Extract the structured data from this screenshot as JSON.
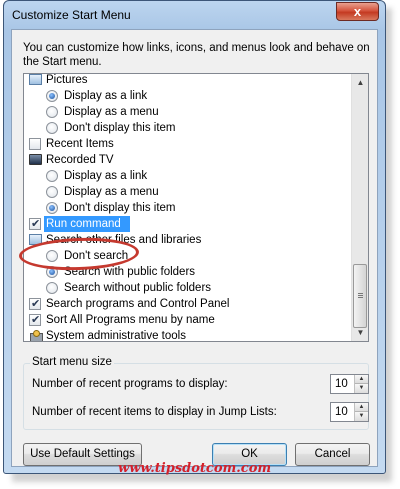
{
  "window": {
    "title": "Customize Start Menu",
    "close_glyph": "x",
    "intro": "You can customize how links, icons, and menus look and behave on the Start menu."
  },
  "list": {
    "rows": [
      {
        "kind": "header",
        "icon": "pictures-icon",
        "label": "Pictures"
      },
      {
        "kind": "radio",
        "checked": true,
        "label": "Display as a link"
      },
      {
        "kind": "radio",
        "checked": false,
        "label": "Display as a menu"
      },
      {
        "kind": "radio",
        "checked": false,
        "label": "Don't display this item"
      },
      {
        "kind": "check",
        "checked": false,
        "label": "Recent Items"
      },
      {
        "kind": "header",
        "icon": "recorded-tv-icon",
        "label": "Recorded TV"
      },
      {
        "kind": "radio",
        "checked": false,
        "label": "Display as a link"
      },
      {
        "kind": "radio",
        "checked": false,
        "label": "Display as a menu"
      },
      {
        "kind": "radio",
        "checked": true,
        "label": "Don't display this item"
      },
      {
        "kind": "check",
        "checked": true,
        "label": "Run command",
        "selected": true
      },
      {
        "kind": "header",
        "icon": "search-icon",
        "label": "Search other files and libraries"
      },
      {
        "kind": "radio",
        "checked": false,
        "label": "Don't search"
      },
      {
        "kind": "radio",
        "checked": true,
        "label": "Search with public folders"
      },
      {
        "kind": "radio",
        "checked": false,
        "label": "Search without public folders"
      },
      {
        "kind": "check",
        "checked": true,
        "label": "Search programs and Control Panel"
      },
      {
        "kind": "check",
        "checked": true,
        "label": "Sort All Programs menu by name"
      },
      {
        "kind": "header",
        "icon": "tools-icon",
        "label": "System administrative tools"
      }
    ],
    "selection_color": "#3399ff",
    "annotation_color": "#c5392f"
  },
  "start_menu_size": {
    "title": "Start menu size",
    "recent_programs_label": "Number of recent programs to display:",
    "recent_programs_value": "10",
    "jump_list_label": "Number of recent items to display in Jump Lists:",
    "jump_list_value": "10"
  },
  "buttons": {
    "use_default": "Use Default Settings",
    "ok": "OK",
    "cancel": "Cancel"
  },
  "watermark": "www.tipsdotcom.com"
}
